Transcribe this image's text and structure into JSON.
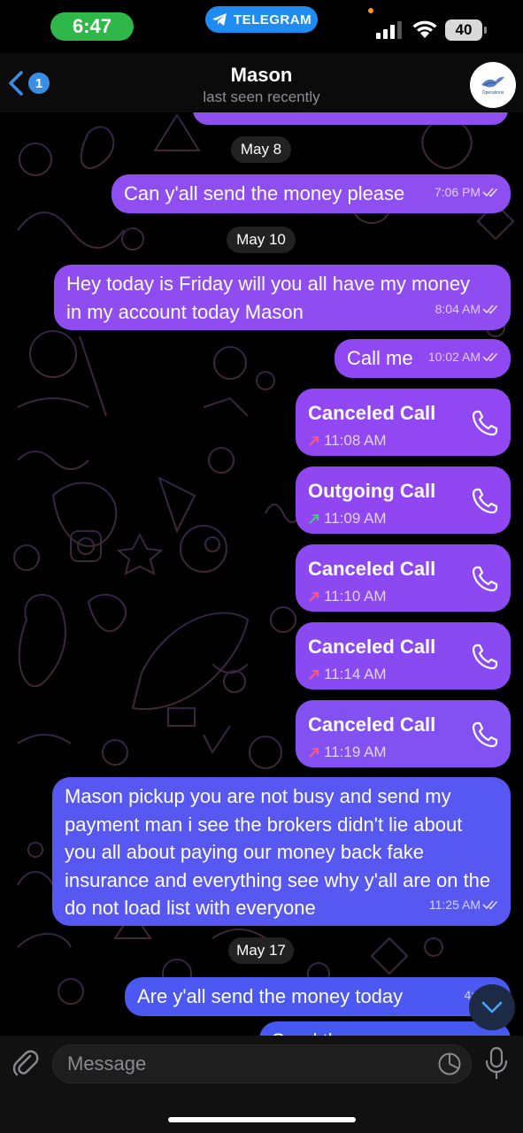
{
  "status_bar": {
    "time": "6:47",
    "app_pill": "TELEGRAM",
    "battery": "40"
  },
  "header": {
    "back_count": "1",
    "contact_name": "Mason",
    "contact_status": "last seen recently",
    "avatar_text": "Operations"
  },
  "dates": [
    "May 8",
    "May 10",
    "May 17"
  ],
  "messages": [
    {
      "text": "Can y'all send the money please",
      "time": "7:06 PM"
    },
    {
      "text_line1": "Hey today is Friday will you all have my money",
      "text_line2": "in my account today Mason",
      "time": "8:04 AM"
    },
    {
      "text": "Call me",
      "time": "10:02 AM"
    },
    {
      "text": "Mason pickup you are not busy and send my payment man i see the brokers didn't lie about you all about paying our money back fake insurance and everything see why y'all are on the do not load list with everyone",
      "time": "11:25 AM"
    },
    {
      "text": "Are y'all send the money today",
      "time": "4:27 P"
    },
    {
      "text": "Send the money"
    }
  ],
  "calls": [
    {
      "title": "Canceled Call",
      "time": "11:08 AM",
      "direction": "canceled",
      "arrow_color": "#ff5a6e"
    },
    {
      "title": "Outgoing Call",
      "time": "11:09 AM",
      "direction": "outgoing",
      "arrow_color": "#3fd16b"
    },
    {
      "title": "Canceled Call",
      "time": "11:10 AM",
      "direction": "canceled",
      "arrow_color": "#ff5a6e"
    },
    {
      "title": "Canceled Call",
      "time": "11:14 AM",
      "direction": "canceled",
      "arrow_color": "#ff5a6e"
    },
    {
      "title": "Canceled Call",
      "time": "11:19 AM",
      "direction": "canceled",
      "arrow_color": "#ff5a6e"
    }
  ],
  "input": {
    "placeholder": "Message"
  },
  "colors": {
    "bubble_purple": "#8f4ff0",
    "bubble_blue": "#4b58f2",
    "telegram_blue": "#1e8cf0",
    "time_green": "#2fb74a"
  }
}
